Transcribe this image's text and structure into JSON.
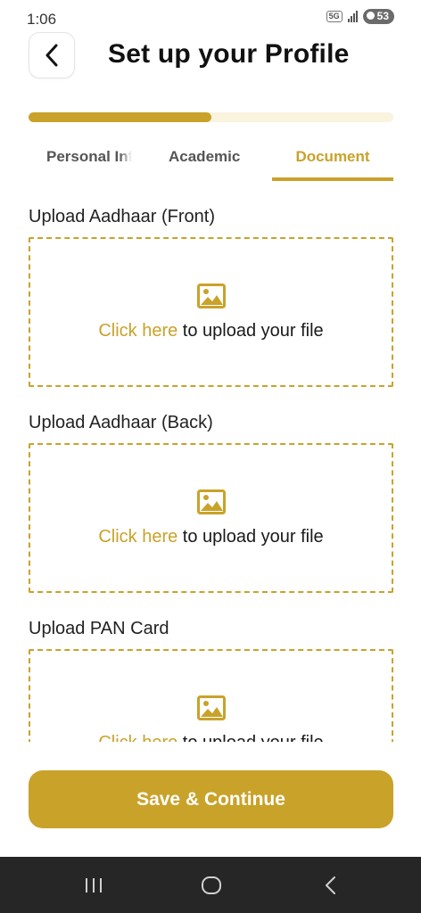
{
  "status": {
    "time": "1:06",
    "network": "5G",
    "battery": "53"
  },
  "header": {
    "title": "Set up your Profile",
    "back_icon": "chevron-left-icon"
  },
  "progress": {
    "fraction": 0.5
  },
  "tabs": [
    {
      "label": "Personal Information",
      "active": false
    },
    {
      "label": "Academic",
      "active": false
    },
    {
      "label": "Document",
      "active": true
    }
  ],
  "uploads": [
    {
      "label": "Upload Aadhaar (Front)",
      "link_text": "Click here",
      "rest_text": " to upload your file",
      "icon": "image-icon"
    },
    {
      "label": "Upload Aadhaar (Back)",
      "link_text": "Click here",
      "rest_text": " to upload your file",
      "icon": "image-icon"
    },
    {
      "label": "Upload PAN Card",
      "link_text": "Click here",
      "rest_text": " to upload your file",
      "icon": "image-icon"
    }
  ],
  "actions": {
    "save_label": "Save & Continue"
  },
  "nav": {
    "recents_icon": "recents-icon",
    "home_icon": "home-icon",
    "back_icon": "back-icon"
  },
  "colors": {
    "accent": "#c9a22a",
    "track": "#faf3dd",
    "navbar": "#262626"
  }
}
